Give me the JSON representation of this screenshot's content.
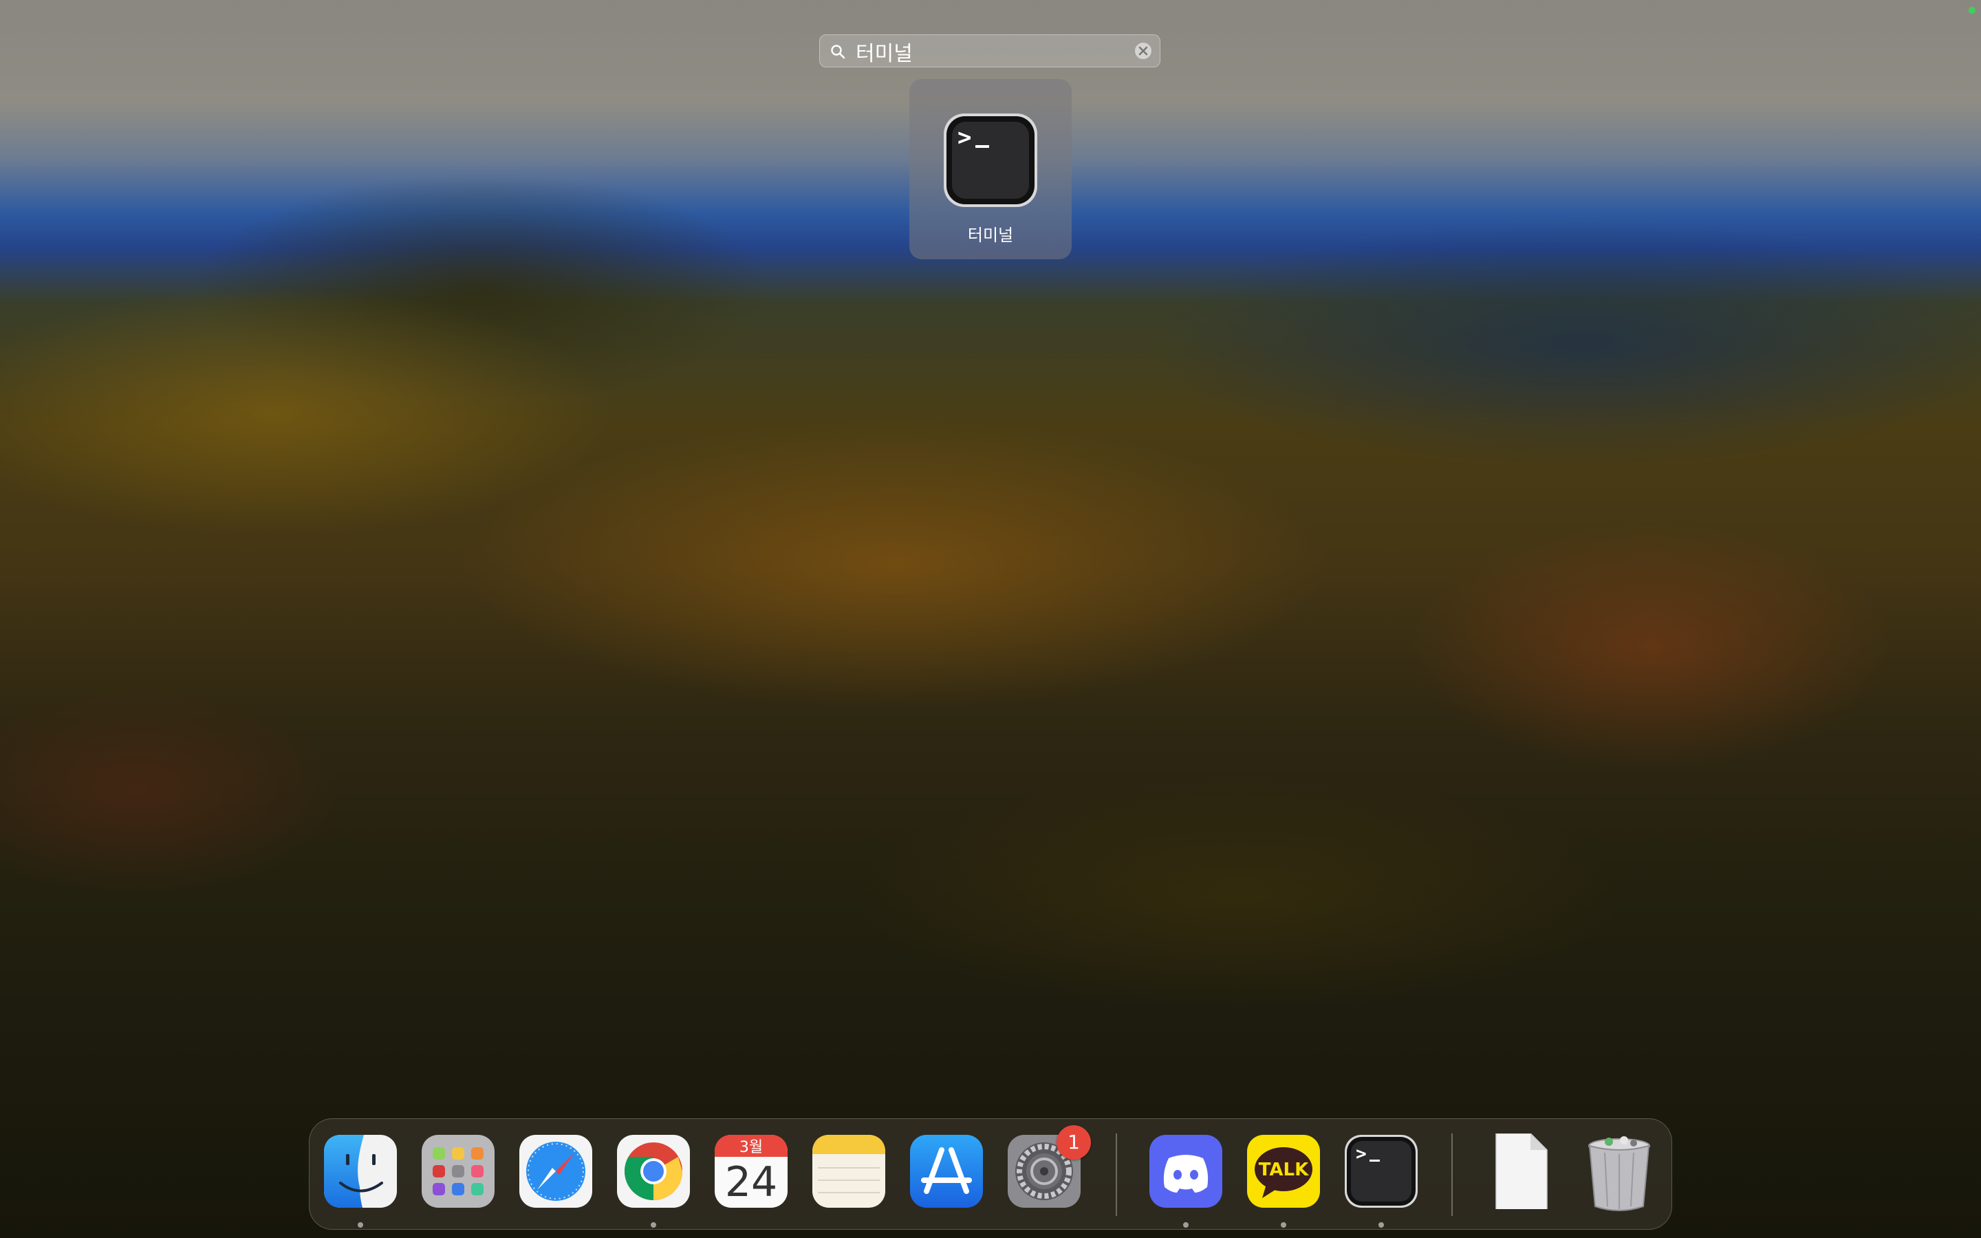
{
  "search": {
    "query": "터미널",
    "icon": "search-icon",
    "clear_icon": "clear-icon"
  },
  "result": {
    "app_name": "터미널",
    "icon": "terminal-icon"
  },
  "dock": {
    "apps": [
      {
        "name": "Finder",
        "icon": "finder-icon",
        "running": true
      },
      {
        "name": "Launchpad",
        "icon": "launchpad-icon",
        "running": false
      },
      {
        "name": "Safari",
        "icon": "safari-icon",
        "running": false
      },
      {
        "name": "Chrome",
        "icon": "chrome-icon",
        "running": true
      },
      {
        "name": "Calendar",
        "icon": "calendar-icon",
        "running": false,
        "month": "3월",
        "day": "24"
      },
      {
        "name": "Notes",
        "icon": "notes-icon",
        "running": false
      },
      {
        "name": "App Store",
        "icon": "app-store-icon",
        "running": false
      },
      {
        "name": "System Settings",
        "icon": "settings-icon",
        "running": false,
        "badge": "1"
      },
      {
        "name": "Discord",
        "icon": "discord-icon",
        "running": true
      },
      {
        "name": "KakaoTalk",
        "icon": "kakaotalk-icon",
        "running": true,
        "text": "TALK"
      },
      {
        "name": "Terminal",
        "icon": "terminal-icon",
        "running": true
      },
      {
        "name": "Document",
        "icon": "document-icon",
        "running": false
      },
      {
        "name": "Trash",
        "icon": "trash-icon",
        "running": false
      }
    ]
  },
  "colors": {
    "badge": "#e6463a",
    "kakao": "#fae100",
    "discord": "#5865f2",
    "status_dot": "#3fd05a"
  }
}
